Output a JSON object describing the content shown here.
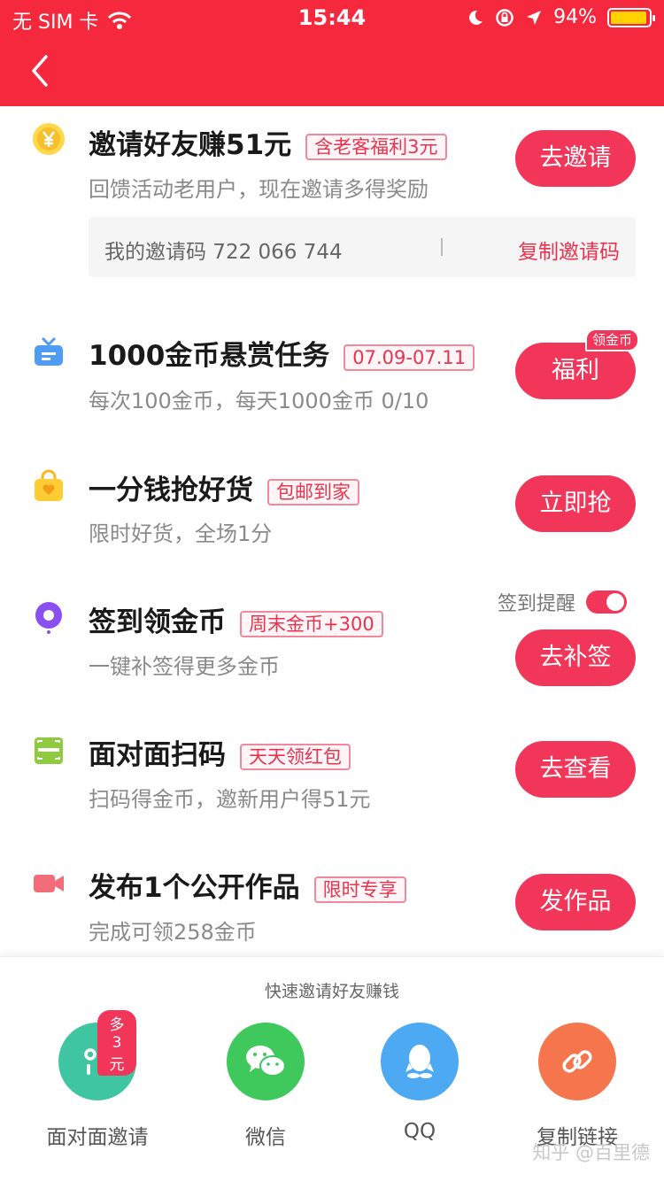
{
  "status_bar": {
    "carrier": "无 SIM 卡",
    "time": "15:44",
    "battery": "94%",
    "battery_level": 0.94
  },
  "tasks": [
    {
      "title": "邀请好友赚51元",
      "tag": "含老客福利3元",
      "subtitle": "回馈活动老用户，现在邀请多得奖励",
      "button": "去邀请"
    },
    {
      "title": "1000金币悬赏任务",
      "tag": "07.09-07.11",
      "subtitle": "每次100金币，每天1000金币 0/10",
      "button": "福利",
      "badge": "领金币"
    },
    {
      "title": "一分钱抢好货",
      "tag": "包邮到家",
      "subtitle": "限时好货，全场1分",
      "button": "立即抢"
    },
    {
      "title": "签到领金币",
      "tag": "周末金币+300",
      "subtitle": "一键补签得更多金币",
      "button": "去补签"
    },
    {
      "title": "面对面扫码",
      "tag": "天天领红包",
      "subtitle": "扫码得金币，邀新用户得51元",
      "button": "去查看"
    },
    {
      "title": "发布1个公开作品",
      "tag": "限时专享",
      "subtitle": "完成可领258金币",
      "button": "发作品"
    }
  ],
  "invite": {
    "code_text": "我的邀请码 722 066 744",
    "copy_label": "复制邀请码"
  },
  "checkin": {
    "remind_label": "签到提醒",
    "remind_on": true
  },
  "share": {
    "title": "快速邀请好友赚钱",
    "items": [
      {
        "label": "面对面邀请",
        "badge": "多3元",
        "color": "#3fc6a0",
        "icon": "face-to-face-icon"
      },
      {
        "label": "微信",
        "color": "#3fc85c",
        "icon": "wechat-icon"
      },
      {
        "label": "QQ",
        "color": "#4ea9f3",
        "icon": "qq-icon"
      },
      {
        "label": "复制链接",
        "color": "#f5764d",
        "icon": "link-icon"
      }
    ]
  },
  "watermark": "知乎 @百里德"
}
